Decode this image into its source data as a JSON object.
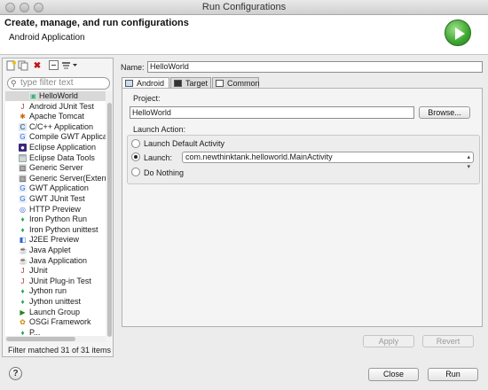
{
  "window": {
    "title": "Run Configurations"
  },
  "header": {
    "title": "Create, manage, and run configurations",
    "subtitle": "Android Application",
    "logo_icon": "run-icon"
  },
  "left": {
    "filter_placeholder": "type filter text",
    "toolbar": [
      "new-configuration-icon",
      "duplicate-icon",
      "delete-icon",
      "collapse-all-icon",
      "filter-dropdown-icon"
    ],
    "items": [
      {
        "label": "HelloWorld",
        "icon": "android-app-icon",
        "selected": true,
        "child": true
      },
      {
        "label": "Android JUnit Test",
        "icon": "junit-icon"
      },
      {
        "label": "Apache Tomcat",
        "icon": "tomcat-icon"
      },
      {
        "label": "C/C++ Application",
        "icon": "c-app-icon"
      },
      {
        "label": "Compile GWT Applicati",
        "icon": "gwt-icon"
      },
      {
        "label": "Eclipse Application",
        "icon": "eclipse-icon"
      },
      {
        "label": "Eclipse Data Tools",
        "icon": "data-tools-icon"
      },
      {
        "label": "Generic Server",
        "icon": "server-icon"
      },
      {
        "label": "Generic Server(Externa",
        "icon": "server-icon"
      },
      {
        "label": "GWT Application",
        "icon": "gwt-icon"
      },
      {
        "label": "GWT JUnit Test",
        "icon": "gwt-icon"
      },
      {
        "label": "HTTP Preview",
        "icon": "http-icon"
      },
      {
        "label": "Iron Python Run",
        "icon": "python-icon"
      },
      {
        "label": "Iron Python unittest",
        "icon": "python-icon"
      },
      {
        "label": "J2EE Preview",
        "icon": "j2ee-icon"
      },
      {
        "label": "Java Applet",
        "icon": "java-icon"
      },
      {
        "label": "Java Application",
        "icon": "java-icon"
      },
      {
        "label": "JUnit",
        "icon": "junit-icon"
      },
      {
        "label": "JUnit Plug-in Test",
        "icon": "junit-icon"
      },
      {
        "label": "Jython run",
        "icon": "python-icon"
      },
      {
        "label": "Jython unittest",
        "icon": "python-icon"
      },
      {
        "label": "Launch Group",
        "icon": "launch-group-icon"
      },
      {
        "label": "OSGi Framework",
        "icon": "osgi-icon"
      },
      {
        "label": "P...",
        "icon": "python-icon"
      }
    ],
    "status": "Filter matched 31 of 31 items"
  },
  "right": {
    "name_label": "Name:",
    "name_value": "HelloWorld",
    "tabs": [
      {
        "label": "Android",
        "active": true
      },
      {
        "label": "Target",
        "active": false
      },
      {
        "label": "Common",
        "active": false
      }
    ],
    "project_label": "Project:",
    "project_value": "HelloWorld",
    "browse_label": "Browse...",
    "launch_action_label": "Launch Action:",
    "radio_default": "Launch Default Activity",
    "radio_launch": "Launch:",
    "launch_activity": "com.newthinktank.helloworld.MainActivity",
    "radio_nothing": "Do Nothing",
    "apply_label": "Apply",
    "revert_label": "Revert"
  },
  "footer": {
    "close_label": "Close",
    "run_label": "Run",
    "help_glyph": "?"
  }
}
